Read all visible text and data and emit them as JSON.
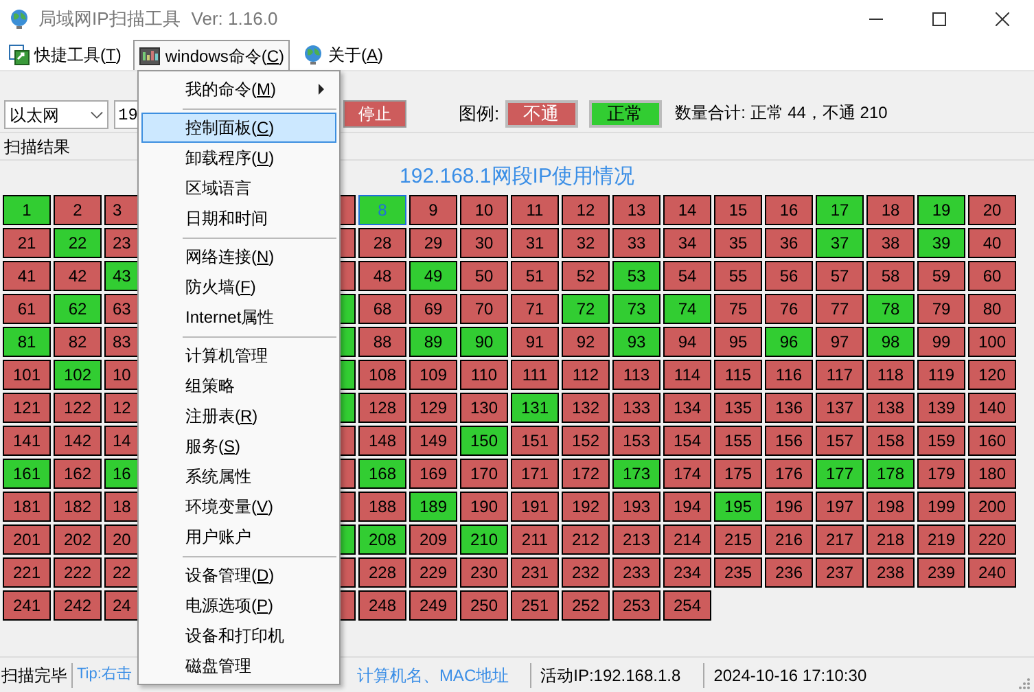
{
  "window": {
    "title": "局域网IP扫描工具",
    "version": "Ver: 1.16.0"
  },
  "menubar": [
    {
      "before": "快捷工具(",
      "key": "T",
      "after": ")",
      "selected": false
    },
    {
      "before": "windows命令(",
      "key": "C",
      "after": ")",
      "selected": true
    },
    {
      "before": "关于(",
      "key": "A",
      "after": ")",
      "selected": false
    }
  ],
  "toolbar": {
    "adapter": "以太网",
    "ip_input": "19",
    "stop_button": "停止",
    "legend_label": "图例:",
    "legend": [
      {
        "label": "不通",
        "up": false
      },
      {
        "label": "正常",
        "up": true
      }
    ],
    "summary": "数量合计: 正常 44，不通 210"
  },
  "section_label": "扫描结果",
  "grid_title": "192.168.1网段IP使用情况",
  "rows": [
    {
      "left": [
        {
          "ip": "1",
          "up": true,
          "selected": false
        },
        {
          "ip": "2",
          "up": false,
          "selected": false
        },
        {
          "ip": "3",
          "up": false,
          "selected": false
        }
      ],
      "edge": {
        "up": false,
        "selected": false
      },
      "right": [
        {
          "ip": "8",
          "up": true,
          "selected": true
        },
        {
          "ip": "9",
          "up": false,
          "selected": false
        },
        {
          "ip": "10",
          "up": false,
          "selected": false
        },
        {
          "ip": "11",
          "up": false,
          "selected": false
        },
        {
          "ip": "12",
          "up": false,
          "selected": false
        },
        {
          "ip": "13",
          "up": false,
          "selected": false
        },
        {
          "ip": "14",
          "up": false,
          "selected": false
        },
        {
          "ip": "15",
          "up": false,
          "selected": false
        },
        {
          "ip": "16",
          "up": false,
          "selected": false
        },
        {
          "ip": "17",
          "up": true,
          "selected": false
        },
        {
          "ip": "18",
          "up": false,
          "selected": false
        },
        {
          "ip": "19",
          "up": true,
          "selected": false
        },
        {
          "ip": "20",
          "up": false,
          "selected": false
        }
      ]
    },
    {
      "left": [
        {
          "ip": "21",
          "up": false,
          "selected": false
        },
        {
          "ip": "22",
          "up": true,
          "selected": false
        },
        {
          "ip": "23",
          "up": false,
          "selected": false
        }
      ],
      "edge": {
        "up": false,
        "selected": false
      },
      "right": [
        {
          "ip": "28",
          "up": false,
          "selected": false
        },
        {
          "ip": "29",
          "up": false,
          "selected": false
        },
        {
          "ip": "30",
          "up": false,
          "selected": false
        },
        {
          "ip": "31",
          "up": false,
          "selected": false
        },
        {
          "ip": "32",
          "up": false,
          "selected": false
        },
        {
          "ip": "33",
          "up": false,
          "selected": false
        },
        {
          "ip": "34",
          "up": false,
          "selected": false
        },
        {
          "ip": "35",
          "up": false,
          "selected": false
        },
        {
          "ip": "36",
          "up": false,
          "selected": false
        },
        {
          "ip": "37",
          "up": true,
          "selected": false
        },
        {
          "ip": "38",
          "up": false,
          "selected": false
        },
        {
          "ip": "39",
          "up": true,
          "selected": false
        },
        {
          "ip": "40",
          "up": false,
          "selected": false
        }
      ]
    },
    {
      "left": [
        {
          "ip": "41",
          "up": false,
          "selected": false
        },
        {
          "ip": "42",
          "up": false,
          "selected": false
        },
        {
          "ip": "43",
          "up": true,
          "selected": false
        }
      ],
      "edge": {
        "up": false,
        "selected": false
      },
      "right": [
        {
          "ip": "48",
          "up": false,
          "selected": false
        },
        {
          "ip": "49",
          "up": true,
          "selected": false
        },
        {
          "ip": "50",
          "up": false,
          "selected": false
        },
        {
          "ip": "51",
          "up": false,
          "selected": false
        },
        {
          "ip": "52",
          "up": false,
          "selected": false
        },
        {
          "ip": "53",
          "up": true,
          "selected": false
        },
        {
          "ip": "54",
          "up": false,
          "selected": false
        },
        {
          "ip": "55",
          "up": false,
          "selected": false
        },
        {
          "ip": "56",
          "up": false,
          "selected": false
        },
        {
          "ip": "57",
          "up": false,
          "selected": false
        },
        {
          "ip": "58",
          "up": false,
          "selected": false
        },
        {
          "ip": "59",
          "up": false,
          "selected": false
        },
        {
          "ip": "60",
          "up": false,
          "selected": false
        }
      ]
    },
    {
      "left": [
        {
          "ip": "61",
          "up": false,
          "selected": false
        },
        {
          "ip": "62",
          "up": true,
          "selected": false
        },
        {
          "ip": "63",
          "up": false,
          "selected": false
        }
      ],
      "edge": {
        "up": true,
        "selected": false
      },
      "right": [
        {
          "ip": "68",
          "up": false,
          "selected": false
        },
        {
          "ip": "69",
          "up": false,
          "selected": false
        },
        {
          "ip": "70",
          "up": false,
          "selected": false
        },
        {
          "ip": "71",
          "up": false,
          "selected": false
        },
        {
          "ip": "72",
          "up": true,
          "selected": false
        },
        {
          "ip": "73",
          "up": true,
          "selected": false
        },
        {
          "ip": "74",
          "up": true,
          "selected": false
        },
        {
          "ip": "75",
          "up": false,
          "selected": false
        },
        {
          "ip": "76",
          "up": false,
          "selected": false
        },
        {
          "ip": "77",
          "up": false,
          "selected": false
        },
        {
          "ip": "78",
          "up": true,
          "selected": false
        },
        {
          "ip": "79",
          "up": false,
          "selected": false
        },
        {
          "ip": "80",
          "up": false,
          "selected": false
        }
      ]
    },
    {
      "left": [
        {
          "ip": "81",
          "up": true,
          "selected": false
        },
        {
          "ip": "82",
          "up": false,
          "selected": false
        },
        {
          "ip": "83",
          "up": false,
          "selected": false
        }
      ],
      "edge": {
        "up": true,
        "selected": false
      },
      "right": [
        {
          "ip": "88",
          "up": false,
          "selected": false
        },
        {
          "ip": "89",
          "up": true,
          "selected": false
        },
        {
          "ip": "90",
          "up": true,
          "selected": false
        },
        {
          "ip": "91",
          "up": false,
          "selected": false
        },
        {
          "ip": "92",
          "up": false,
          "selected": false
        },
        {
          "ip": "93",
          "up": true,
          "selected": false
        },
        {
          "ip": "94",
          "up": false,
          "selected": false
        },
        {
          "ip": "95",
          "up": false,
          "selected": false
        },
        {
          "ip": "96",
          "up": true,
          "selected": false
        },
        {
          "ip": "97",
          "up": false,
          "selected": false
        },
        {
          "ip": "98",
          "up": true,
          "selected": false
        },
        {
          "ip": "99",
          "up": false,
          "selected": false
        },
        {
          "ip": "100",
          "up": false,
          "selected": false
        }
      ]
    },
    {
      "left": [
        {
          "ip": "101",
          "up": false,
          "selected": false
        },
        {
          "ip": "102",
          "up": true,
          "selected": false
        },
        {
          "ip": "10",
          "up": false,
          "selected": false
        }
      ],
      "edge": {
        "up": true,
        "selected": false
      },
      "right": [
        {
          "ip": "108",
          "up": false,
          "selected": false
        },
        {
          "ip": "109",
          "up": false,
          "selected": false
        },
        {
          "ip": "110",
          "up": false,
          "selected": false
        },
        {
          "ip": "111",
          "up": false,
          "selected": false
        },
        {
          "ip": "112",
          "up": false,
          "selected": false
        },
        {
          "ip": "113",
          "up": false,
          "selected": false
        },
        {
          "ip": "114",
          "up": false,
          "selected": false
        },
        {
          "ip": "115",
          "up": false,
          "selected": false
        },
        {
          "ip": "116",
          "up": false,
          "selected": false
        },
        {
          "ip": "117",
          "up": false,
          "selected": false
        },
        {
          "ip": "118",
          "up": false,
          "selected": false
        },
        {
          "ip": "119",
          "up": false,
          "selected": false
        },
        {
          "ip": "120",
          "up": false,
          "selected": false
        }
      ]
    },
    {
      "left": [
        {
          "ip": "121",
          "up": false,
          "selected": false
        },
        {
          "ip": "122",
          "up": false,
          "selected": false
        },
        {
          "ip": "12",
          "up": false,
          "selected": false
        }
      ],
      "edge": {
        "up": true,
        "selected": false
      },
      "right": [
        {
          "ip": "128",
          "up": false,
          "selected": false
        },
        {
          "ip": "129",
          "up": false,
          "selected": false
        },
        {
          "ip": "130",
          "up": false,
          "selected": false
        },
        {
          "ip": "131",
          "up": true,
          "selected": false
        },
        {
          "ip": "132",
          "up": false,
          "selected": false
        },
        {
          "ip": "133",
          "up": false,
          "selected": false
        },
        {
          "ip": "134",
          "up": false,
          "selected": false
        },
        {
          "ip": "135",
          "up": false,
          "selected": false
        },
        {
          "ip": "136",
          "up": false,
          "selected": false
        },
        {
          "ip": "137",
          "up": false,
          "selected": false
        },
        {
          "ip": "138",
          "up": false,
          "selected": false
        },
        {
          "ip": "139",
          "up": false,
          "selected": false
        },
        {
          "ip": "140",
          "up": false,
          "selected": false
        }
      ]
    },
    {
      "left": [
        {
          "ip": "141",
          "up": false,
          "selected": false
        },
        {
          "ip": "142",
          "up": false,
          "selected": false
        },
        {
          "ip": "14",
          "up": false,
          "selected": false
        }
      ],
      "edge": {
        "up": false,
        "selected": false
      },
      "right": [
        {
          "ip": "148",
          "up": false,
          "selected": false
        },
        {
          "ip": "149",
          "up": false,
          "selected": false
        },
        {
          "ip": "150",
          "up": true,
          "selected": false
        },
        {
          "ip": "151",
          "up": false,
          "selected": false
        },
        {
          "ip": "152",
          "up": false,
          "selected": false
        },
        {
          "ip": "153",
          "up": false,
          "selected": false
        },
        {
          "ip": "154",
          "up": false,
          "selected": false
        },
        {
          "ip": "155",
          "up": false,
          "selected": false
        },
        {
          "ip": "156",
          "up": false,
          "selected": false
        },
        {
          "ip": "157",
          "up": false,
          "selected": false
        },
        {
          "ip": "158",
          "up": false,
          "selected": false
        },
        {
          "ip": "159",
          "up": false,
          "selected": false
        },
        {
          "ip": "160",
          "up": false,
          "selected": false
        }
      ]
    },
    {
      "left": [
        {
          "ip": "161",
          "up": true,
          "selected": false
        },
        {
          "ip": "162",
          "up": false,
          "selected": false
        },
        {
          "ip": "16",
          "up": true,
          "selected": false
        }
      ],
      "edge": {
        "up": false,
        "selected": false
      },
      "right": [
        {
          "ip": "168",
          "up": true,
          "selected": false
        },
        {
          "ip": "169",
          "up": false,
          "selected": false
        },
        {
          "ip": "170",
          "up": false,
          "selected": false
        },
        {
          "ip": "171",
          "up": false,
          "selected": false
        },
        {
          "ip": "172",
          "up": false,
          "selected": false
        },
        {
          "ip": "173",
          "up": true,
          "selected": false
        },
        {
          "ip": "174",
          "up": false,
          "selected": false
        },
        {
          "ip": "175",
          "up": false,
          "selected": false
        },
        {
          "ip": "176",
          "up": false,
          "selected": false
        },
        {
          "ip": "177",
          "up": true,
          "selected": false
        },
        {
          "ip": "178",
          "up": true,
          "selected": false
        },
        {
          "ip": "179",
          "up": false,
          "selected": false
        },
        {
          "ip": "180",
          "up": false,
          "selected": false
        }
      ]
    },
    {
      "left": [
        {
          "ip": "181",
          "up": false,
          "selected": false
        },
        {
          "ip": "182",
          "up": false,
          "selected": false
        },
        {
          "ip": "18",
          "up": false,
          "selected": false
        }
      ],
      "edge": {
        "up": false,
        "selected": false
      },
      "right": [
        {
          "ip": "188",
          "up": false,
          "selected": false
        },
        {
          "ip": "189",
          "up": true,
          "selected": false
        },
        {
          "ip": "190",
          "up": false,
          "selected": false
        },
        {
          "ip": "191",
          "up": false,
          "selected": false
        },
        {
          "ip": "192",
          "up": false,
          "selected": false
        },
        {
          "ip": "193",
          "up": false,
          "selected": false
        },
        {
          "ip": "194",
          "up": false,
          "selected": false
        },
        {
          "ip": "195",
          "up": true,
          "selected": false
        },
        {
          "ip": "196",
          "up": false,
          "selected": false
        },
        {
          "ip": "197",
          "up": false,
          "selected": false
        },
        {
          "ip": "198",
          "up": false,
          "selected": false
        },
        {
          "ip": "199",
          "up": false,
          "selected": false
        },
        {
          "ip": "200",
          "up": false,
          "selected": false
        }
      ]
    },
    {
      "left": [
        {
          "ip": "201",
          "up": false,
          "selected": false
        },
        {
          "ip": "202",
          "up": false,
          "selected": false
        },
        {
          "ip": "20",
          "up": false,
          "selected": false
        }
      ],
      "edge": {
        "up": true,
        "selected": false
      },
      "right": [
        {
          "ip": "208",
          "up": true,
          "selected": false
        },
        {
          "ip": "209",
          "up": false,
          "selected": false
        },
        {
          "ip": "210",
          "up": true,
          "selected": false
        },
        {
          "ip": "211",
          "up": false,
          "selected": false
        },
        {
          "ip": "212",
          "up": false,
          "selected": false
        },
        {
          "ip": "213",
          "up": false,
          "selected": false
        },
        {
          "ip": "214",
          "up": false,
          "selected": false
        },
        {
          "ip": "215",
          "up": false,
          "selected": false
        },
        {
          "ip": "216",
          "up": false,
          "selected": false
        },
        {
          "ip": "217",
          "up": false,
          "selected": false
        },
        {
          "ip": "218",
          "up": false,
          "selected": false
        },
        {
          "ip": "219",
          "up": false,
          "selected": false
        },
        {
          "ip": "220",
          "up": false,
          "selected": false
        }
      ]
    },
    {
      "left": [
        {
          "ip": "221",
          "up": false,
          "selected": false
        },
        {
          "ip": "222",
          "up": false,
          "selected": false
        },
        {
          "ip": "22",
          "up": false,
          "selected": false
        }
      ],
      "edge": {
        "up": false,
        "selected": false
      },
      "right": [
        {
          "ip": "228",
          "up": false,
          "selected": false
        },
        {
          "ip": "229",
          "up": false,
          "selected": false
        },
        {
          "ip": "230",
          "up": false,
          "selected": false
        },
        {
          "ip": "231",
          "up": false,
          "selected": false
        },
        {
          "ip": "232",
          "up": false,
          "selected": false
        },
        {
          "ip": "233",
          "up": false,
          "selected": false
        },
        {
          "ip": "234",
          "up": false,
          "selected": false
        },
        {
          "ip": "235",
          "up": false,
          "selected": false
        },
        {
          "ip": "236",
          "up": false,
          "selected": false
        },
        {
          "ip": "237",
          "up": false,
          "selected": false
        },
        {
          "ip": "238",
          "up": false,
          "selected": false
        },
        {
          "ip": "239",
          "up": false,
          "selected": false
        },
        {
          "ip": "240",
          "up": false,
          "selected": false
        }
      ]
    },
    {
      "left": [
        {
          "ip": "241",
          "up": false,
          "selected": false
        },
        {
          "ip": "242",
          "up": false,
          "selected": false
        },
        {
          "ip": "24",
          "up": false,
          "selected": false
        }
      ],
      "edge": {
        "up": false,
        "selected": false
      },
      "right": [
        {
          "ip": "248",
          "up": false,
          "selected": false
        },
        {
          "ip": "249",
          "up": false,
          "selected": false
        },
        {
          "ip": "250",
          "up": false,
          "selected": false
        },
        {
          "ip": "251",
          "up": false,
          "selected": false
        },
        {
          "ip": "252",
          "up": false,
          "selected": false
        },
        {
          "ip": "253",
          "up": false,
          "selected": false
        },
        {
          "ip": "254",
          "up": false,
          "selected": false
        }
      ]
    }
  ],
  "menu": [
    {
      "kind": "item",
      "before": "我的命令(",
      "key": "M",
      "after": ")",
      "submenu": true,
      "selected": false
    },
    {
      "kind": "separator"
    },
    {
      "kind": "item",
      "before": "控制面板(",
      "key": "C",
      "after": ")",
      "selected": true
    },
    {
      "kind": "item",
      "before": "卸载程序(",
      "key": "U",
      "after": ")",
      "selected": false
    },
    {
      "kind": "item",
      "before": "区域语言",
      "selected": false
    },
    {
      "kind": "item",
      "before": "日期和时间",
      "selected": false
    },
    {
      "kind": "separator"
    },
    {
      "kind": "item",
      "before": "网络连接(",
      "key": "N",
      "after": ")",
      "selected": false
    },
    {
      "kind": "item",
      "before": "防火墙(",
      "key": "F",
      "after": ")",
      "selected": false
    },
    {
      "kind": "item",
      "before": "Internet属性",
      "selected": false
    },
    {
      "kind": "separator"
    },
    {
      "kind": "item",
      "before": "计算机管理",
      "selected": false
    },
    {
      "kind": "item",
      "before": "组策略",
      "selected": false
    },
    {
      "kind": "item",
      "before": "注册表(",
      "key": "R",
      "after": ")",
      "selected": false
    },
    {
      "kind": "item",
      "before": "服务(",
      "key": "S",
      "after": ")",
      "selected": false
    },
    {
      "kind": "item",
      "before": "系统属性",
      "selected": false
    },
    {
      "kind": "item",
      "before": "环境变量(",
      "key": "V",
      "after": ")",
      "selected": false
    },
    {
      "kind": "item",
      "before": "用户账户",
      "selected": false
    },
    {
      "kind": "separator"
    },
    {
      "kind": "item",
      "before": "设备管理(",
      "key": "D",
      "after": ")",
      "selected": false
    },
    {
      "kind": "item",
      "before": "电源选项(",
      "key": "P",
      "after": ")",
      "selected": false
    },
    {
      "kind": "item",
      "before": "设备和打印机",
      "selected": false
    },
    {
      "kind": "item",
      "before": "磁盘管理",
      "selected": false
    }
  ],
  "status_bar": {
    "state": "扫描完毕",
    "tip_start": "Tip:右击",
    "tip_end": "计算机名、MAC地址",
    "active_ip": "活动IP:192.168.1.8",
    "time": "2024-10-16 17:10:30"
  }
}
